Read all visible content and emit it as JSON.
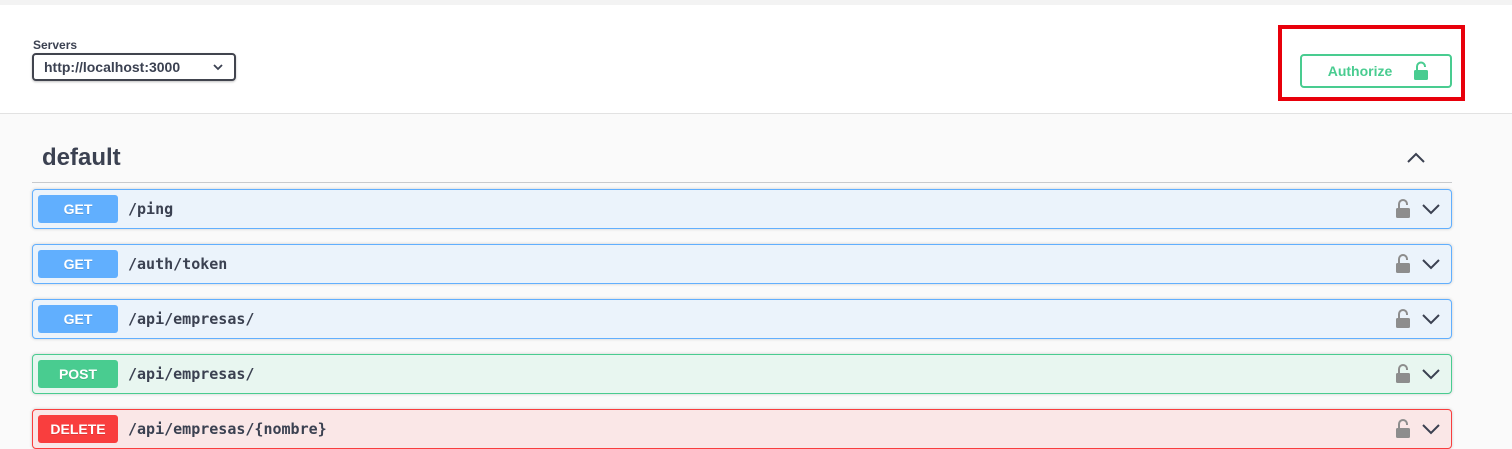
{
  "servers": {
    "label": "Servers",
    "selected": "http://localhost:3000"
  },
  "authorize": {
    "label": "Authorize",
    "color": "#49cc90"
  },
  "tag": {
    "name": "default"
  },
  "operations": [
    {
      "method": "GET",
      "path": "/ping"
    },
    {
      "method": "GET",
      "path": "/auth/token"
    },
    {
      "method": "GET",
      "path": "/api/empresas/"
    },
    {
      "method": "POST",
      "path": "/api/empresas/"
    },
    {
      "method": "DELETE",
      "path": "/api/empresas/{nombre}"
    }
  ],
  "colors": {
    "get": "#61affe",
    "post": "#49cc90",
    "delete": "#f93e3e",
    "highlight": "#e8000b"
  }
}
